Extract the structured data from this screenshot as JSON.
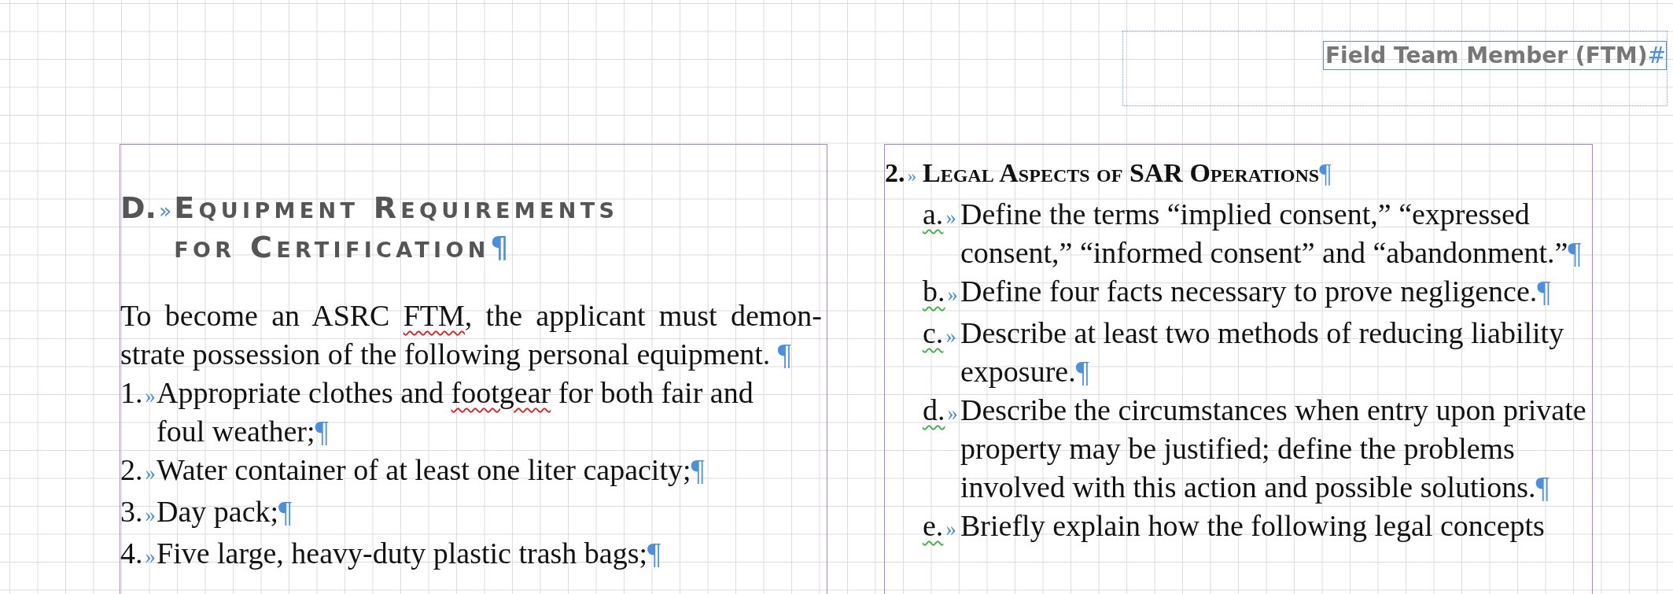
{
  "header": {
    "running_head": [
      {
        "kind": "word",
        "text": "Field Team Member (FTM)"
      },
      {
        "kind": "mark",
        "text": "#"
      }
    ]
  },
  "left_column": {
    "heading": {
      "number": "D.",
      "tab_mark": "»",
      "segments": [
        {
          "kind": "word",
          "text": "Equipment Requirements for Certification"
        },
        {
          "kind": "mark",
          "text": "¶"
        }
      ]
    },
    "intro": [
      {
        "kind": "word",
        "text": "To become an ASRC "
      },
      {
        "kind": "misspelled",
        "text": "FTM"
      },
      {
        "kind": "word",
        "text": ", the applicant must demon-strate possession of the following personal equipment. "
      },
      {
        "kind": "mark",
        "text": "¶"
      }
    ],
    "items": [
      {
        "number": "1.",
        "tab_mark": "»",
        "segments": [
          {
            "kind": "word",
            "text": "Appropriate clothes and "
          },
          {
            "kind": "misspelled",
            "text": "footgear"
          },
          {
            "kind": "word",
            "text": " for both fair and foul weather;"
          },
          {
            "kind": "mark",
            "text": "¶"
          }
        ]
      },
      {
        "number": "2.",
        "tab_mark": "»",
        "segments": [
          {
            "kind": "word",
            "text": "Water container of at least one liter capacity;"
          },
          {
            "kind": "mark",
            "text": "¶"
          }
        ]
      },
      {
        "number": "3.",
        "tab_mark": "»",
        "segments": [
          {
            "kind": "word",
            "text": "Day pack;"
          },
          {
            "kind": "mark",
            "text": "¶"
          }
        ]
      },
      {
        "number": "4.",
        "tab_mark": "»",
        "segments": [
          {
            "kind": "word",
            "text": "Five large, heavy-duty plastic trash bags;"
          },
          {
            "kind": "mark",
            "text": "¶"
          }
        ]
      }
    ]
  },
  "right_column": {
    "heading": {
      "number": "2.",
      "tab_mark": "»",
      "segments": [
        {
          "kind": "word",
          "text": "Legal Aspects of SAR Operations"
        },
        {
          "kind": "mark",
          "text": "¶"
        }
      ]
    },
    "items": [
      {
        "letter": "a.",
        "grammar_flag": true,
        "tab_mark": "»",
        "segments": [
          {
            "kind": "word",
            "text": "Define the terms “implied consent,” “expressed consent,” “informed consent” and “abandonment.”"
          },
          {
            "kind": "mark",
            "text": "¶"
          }
        ]
      },
      {
        "letter": "b.",
        "grammar_flag": true,
        "tab_mark": "»",
        "segments": [
          {
            "kind": "word",
            "text": "Define four facts necessary to prove negligence."
          },
          {
            "kind": "mark",
            "text": "¶"
          }
        ]
      },
      {
        "letter": "c.",
        "grammar_flag": true,
        "tab_mark": "»",
        "segments": [
          {
            "kind": "word",
            "text": "Describe at least two methods of reducing liability exposure."
          },
          {
            "kind": "mark",
            "text": "¶"
          }
        ]
      },
      {
        "letter": "d.",
        "grammar_flag": true,
        "tab_mark": "»",
        "segments": [
          {
            "kind": "word",
            "text": "Describe the circumstances when entry upon private property may be justified; define the problems involved with this action and possible solutions."
          },
          {
            "kind": "mark",
            "text": "¶"
          }
        ]
      },
      {
        "letter": "e.",
        "grammar_flag": true,
        "tab_mark": "»",
        "segments": [
          {
            "kind": "word",
            "text": "Briefly explain how the following legal concepts"
          }
        ]
      }
    ]
  }
}
